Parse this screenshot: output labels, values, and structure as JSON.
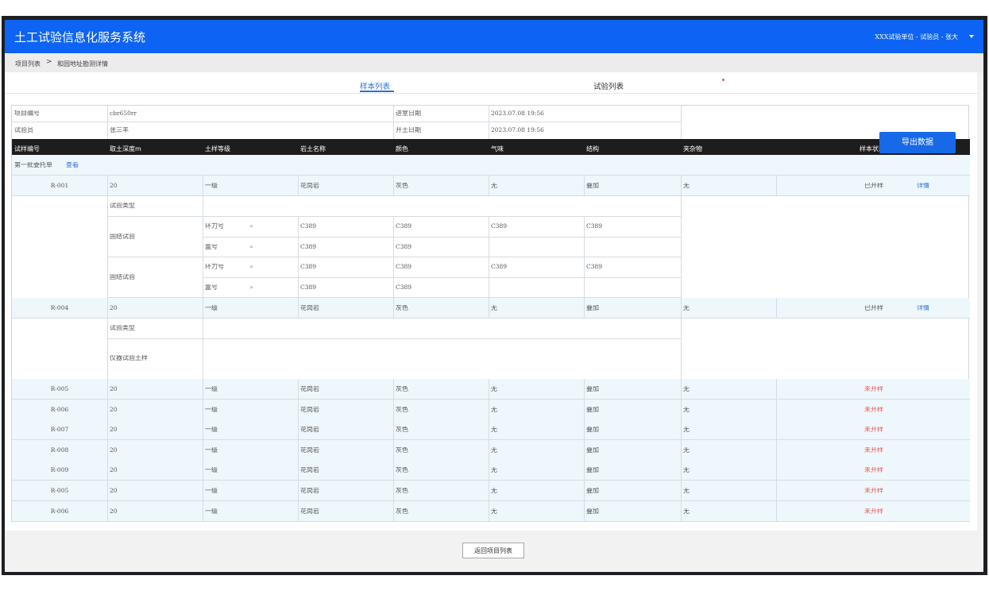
{
  "app": {
    "title": "土工试验信息化服务系统",
    "user": "XXX试验单位 - 试验员 - 张大"
  },
  "breadcrumb": {
    "home": "项目列表",
    "sep": ">",
    "current": "和园地址勘测详情"
  },
  "tabs": [
    {
      "label": "样本列表",
      "active": true
    },
    {
      "label": "试验列表",
      "active": false
    }
  ],
  "info": {
    "project_no_label": "项目编号",
    "project_no": "cbr650rr",
    "tester_label": "试验员",
    "tester": "张三丰",
    "entry_date_label": "进室日期",
    "entry_date": "2023.07.08  19:56",
    "open_date_label": "开土日期",
    "open_date": "2023.07.08  19:56"
  },
  "export_label": "导出数据",
  "columns": [
    "试样编号",
    "取土深度m",
    "土样等级",
    "岩土名称",
    "颜色",
    "气味",
    "结构",
    "夹杂物",
    "样本状态"
  ],
  "batch": {
    "label": "第一批委托单",
    "view": "查看"
  },
  "detail_label": "详情",
  "sub1": {
    "type_label": "试验类型",
    "groups": [
      {
        "name": "固结试验",
        "rows": [
          {
            "k": "环刀号",
            "arrow": "»",
            "v": [
              "C389",
              "C389",
              "C389",
              "C389"
            ]
          },
          {
            "k": "盒号",
            "arrow": "»",
            "v": [
              "C389",
              "C389",
              "",
              ""
            ]
          }
        ]
      },
      {
        "name": "固结试验",
        "rows": [
          {
            "k": "环刀号",
            "arrow": "»",
            "v": [
              "C389",
              "C389",
              "C389",
              "C389"
            ]
          },
          {
            "k": "盒号",
            "arrow": "»",
            "v": [
              "C389",
              "C389",
              "",
              ""
            ]
          }
        ]
      }
    ]
  },
  "sub2": {
    "type_label": "试验类型",
    "name": "仪器试验土样"
  },
  "rows": [
    {
      "id": "R-001",
      "depth": "20",
      "grade": "一级",
      "rock": "花岗岩",
      "color": "灰色",
      "smell": "无",
      "struct": "叠加",
      "incl": "无",
      "status": "已开样"
    },
    {
      "id": "R-004",
      "depth": "20",
      "grade": "一级",
      "rock": "花岗岩",
      "color": "灰色",
      "smell": "无",
      "struct": "叠加",
      "incl": "无",
      "status": "已开样"
    },
    {
      "id": "R-005",
      "depth": "20",
      "grade": "一级",
      "rock": "花岗岩",
      "color": "灰色",
      "smell": "无",
      "struct": "叠加",
      "incl": "无",
      "status": "未开样"
    },
    {
      "id": "R-006",
      "depth": "20",
      "grade": "一级",
      "rock": "花岗岩",
      "color": "灰色",
      "smell": "无",
      "struct": "叠加",
      "incl": "无",
      "status": "未开样"
    },
    {
      "id": "R-007",
      "depth": "20",
      "grade": "一级",
      "rock": "花岗岩",
      "color": "灰色",
      "smell": "无",
      "struct": "叠加",
      "incl": "无",
      "status": "未开样"
    },
    {
      "id": "R-008",
      "depth": "20",
      "grade": "一级",
      "rock": "花岗岩",
      "color": "灰色",
      "smell": "无",
      "struct": "叠加",
      "incl": "无",
      "status": "未开样"
    },
    {
      "id": "R-009",
      "depth": "20",
      "grade": "一级",
      "rock": "花岗岩",
      "color": "灰色",
      "smell": "无",
      "struct": "叠加",
      "incl": "无",
      "status": "未开样"
    },
    {
      "id": "R-005",
      "depth": "20",
      "grade": "一级",
      "rock": "花岗岩",
      "color": "灰色",
      "smell": "无",
      "struct": "叠加",
      "incl": "无",
      "status": "未开样"
    },
    {
      "id": "R-006",
      "depth": "20",
      "grade": "一级",
      "rock": "花岗岩",
      "color": "灰色",
      "smell": "无",
      "struct": "叠加",
      "incl": "无",
      "status": "未开样"
    }
  ],
  "back_label": "返回项目列表",
  "colors": {
    "topbar": "#0d63f3",
    "accent": "#2f6fd6",
    "pending": "#e35858"
  }
}
